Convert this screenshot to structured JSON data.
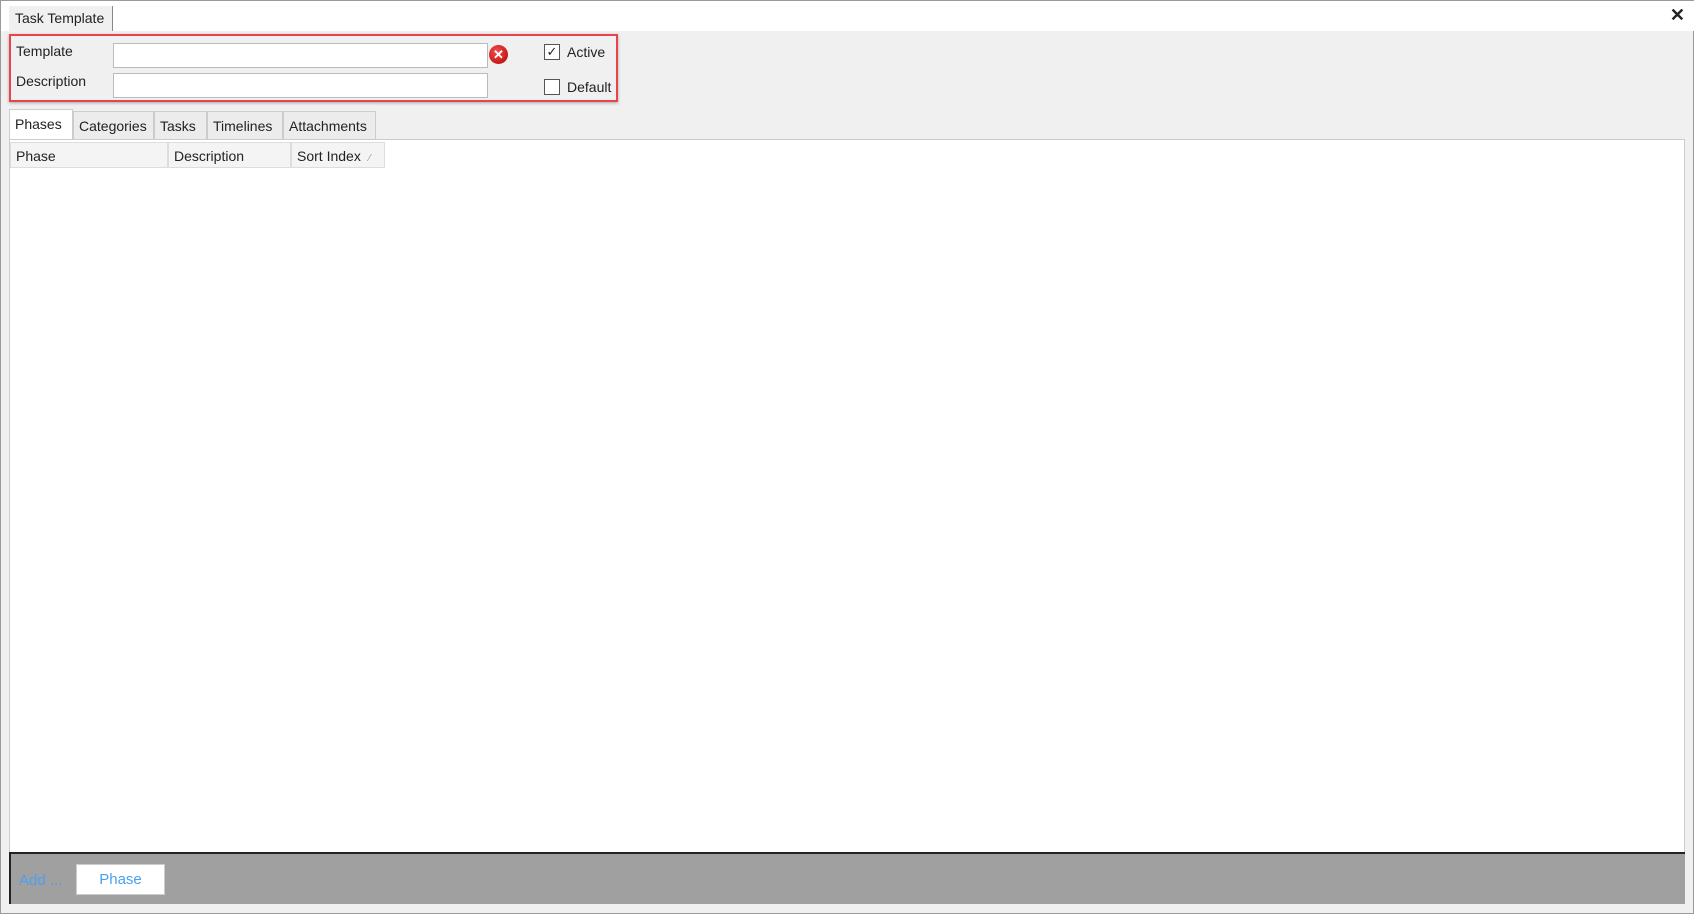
{
  "window": {
    "tab_title": "Task Template",
    "close_icon": "close-icon"
  },
  "form": {
    "template_label": "Template",
    "template_value": "",
    "description_label": "Description",
    "description_value": "",
    "active_label": "Active",
    "active_checked": true,
    "default_label": "Default",
    "default_checked": false,
    "error_icon": "error-icon"
  },
  "tabs": [
    {
      "label": "Phases",
      "active": true
    },
    {
      "label": "Categories"
    },
    {
      "label": "Tasks"
    },
    {
      "label": "Timelines"
    },
    {
      "label": "Attachments"
    }
  ],
  "grid": {
    "columns": [
      "Phase",
      "Description",
      "Sort Index"
    ],
    "rows": []
  },
  "footer": {
    "add_label": "Add ...",
    "phase_button": "Phase"
  },
  "colors": {
    "highlight": "#e8454a",
    "link": "#4aa0f0",
    "footer_bg": "#a0a0a0"
  }
}
